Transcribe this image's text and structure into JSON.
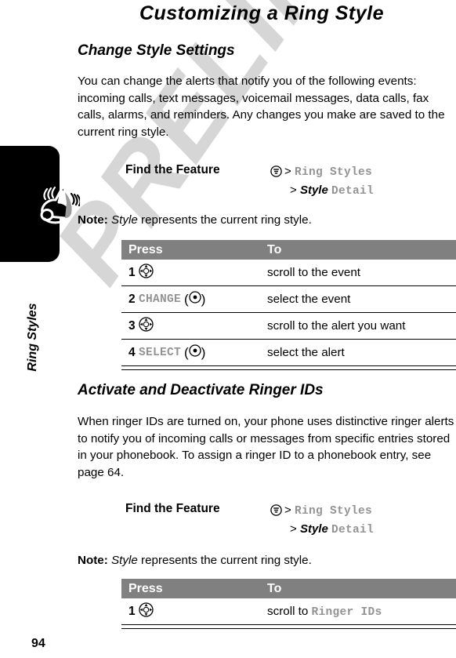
{
  "page": {
    "title": "Customizing a Ring Style",
    "number": "94",
    "watermark": "PRELIMINARY"
  },
  "chapter_tab": {
    "label": "Ring Styles",
    "icon": "ringing-bell-icon"
  },
  "sections": [
    {
      "heading": "Change Style Settings",
      "body": "You can change the alerts that notify you of the following events: incoming calls, text messages, voicemail messages, data calls, fax calls, alarms, and reminders. Any changes you make are saved to the current ring style.",
      "find_the_feature": {
        "label": "Find the Feature",
        "menu_icon": "menu-key-icon",
        "line1_separator": ">",
        "line1_value": "Ring Styles",
        "line2_separator": ">",
        "line2_italic": "Style",
        "line2_value": "Detail"
      },
      "note": {
        "prefix": "Note:",
        "italic": "Style",
        "text": " represents the current ring style."
      },
      "table": {
        "headers": [
          "Press",
          "To"
        ],
        "rows": [
          {
            "num": "1",
            "press_icon": "navigation-key-icon",
            "press_label": "",
            "press_paren": "",
            "to": "scroll to the event"
          },
          {
            "num": "2",
            "press_icon": "select-key-icon",
            "press_label": "CHANGE",
            "press_paren": "paren",
            "to": "select the event"
          },
          {
            "num": "3",
            "press_icon": "navigation-key-icon",
            "press_label": "",
            "press_paren": "",
            "to": "scroll to the alert you want"
          },
          {
            "num": "4",
            "press_icon": "select-key-icon",
            "press_label": "SELECT",
            "press_paren": "paren",
            "to": "select the alert"
          }
        ]
      }
    },
    {
      "heading": "Activate and Deactivate Ringer IDs",
      "body": "When ringer IDs are turned on, your phone uses distinctive ringer alerts to notify you of incoming calls or messages from specific entries stored in your phonebook. To assign a ringer ID to a phonebook entry, see page 64.",
      "find_the_feature": {
        "label": "Find the Feature",
        "menu_icon": "menu-key-icon",
        "line1_separator": ">",
        "line1_value": "Ring Styles",
        "line2_separator": ">",
        "line2_italic": "Style",
        "line2_value": "Detail"
      },
      "note": {
        "prefix": "Note:",
        "italic": "Style",
        "text": " represents the current ring style."
      },
      "table": {
        "headers": [
          "Press",
          "To"
        ],
        "rows": [
          {
            "num": "1",
            "press_icon": "navigation-key-icon",
            "press_label": "",
            "press_paren": "",
            "to_plain": "scroll to ",
            "to_mono": "Ringer IDs"
          }
        ]
      }
    }
  ],
  "colors": {
    "table_header_bg": "#808080",
    "mono_gray": "#939393",
    "watermark": "#d6d6d6",
    "tab_black": "#000000"
  }
}
